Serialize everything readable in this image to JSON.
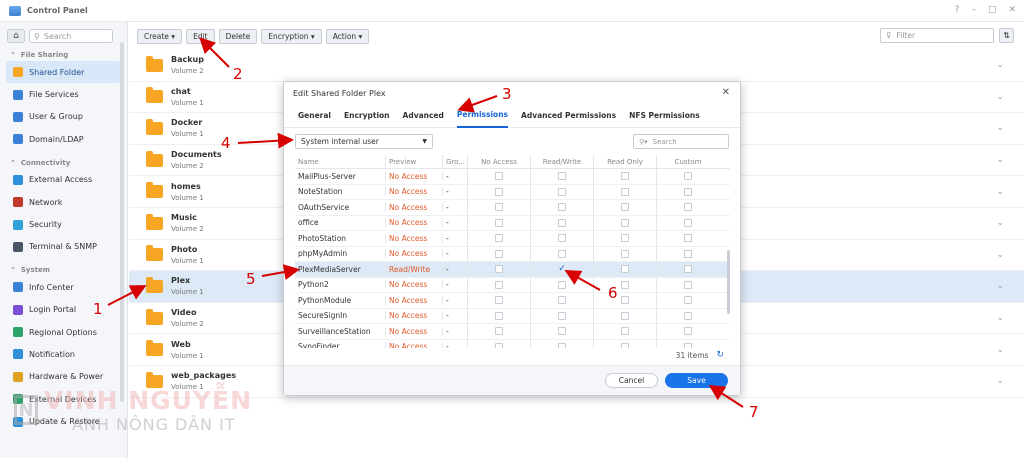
{
  "window": {
    "title": "Control Panel",
    "controls": [
      "?",
      "–",
      "□",
      "✕"
    ]
  },
  "sidebar": {
    "search_placeholder": "Search",
    "sections": [
      {
        "label": "File Sharing",
        "items": [
          {
            "label": "Shared Folder",
            "icon": "shared-folder-icon",
            "color": "#f6a623",
            "active": true
          },
          {
            "label": "File Services",
            "icon": "file-services-icon",
            "color": "#3b82d6"
          },
          {
            "label": "User & Group",
            "icon": "user-group-icon",
            "color": "#3b82d6"
          },
          {
            "label": "Domain/LDAP",
            "icon": "domain-ldap-icon",
            "color": "#3b82d6"
          }
        ]
      },
      {
        "label": "Connectivity",
        "items": [
          {
            "label": "External Access",
            "icon": "globe-icon",
            "color": "#2f8fd8"
          },
          {
            "label": "Network",
            "icon": "network-icon",
            "color": "#c0392b"
          },
          {
            "label": "Security",
            "icon": "shield-icon",
            "color": "#2fa3d8"
          },
          {
            "label": "Terminal & SNMP",
            "icon": "terminal-icon",
            "color": "#4a5568"
          }
        ]
      },
      {
        "label": "System",
        "items": [
          {
            "label": "Info Center",
            "icon": "info-icon",
            "color": "#3b82d6"
          },
          {
            "label": "Login Portal",
            "icon": "login-portal-icon",
            "color": "#7b4fd6"
          },
          {
            "label": "Regional Options",
            "icon": "regional-icon",
            "color": "#2fa36b"
          },
          {
            "label": "Notification",
            "icon": "notification-icon",
            "color": "#2f8fd8"
          },
          {
            "label": "Hardware & Power",
            "icon": "hardware-icon",
            "color": "#e0a020"
          },
          {
            "label": "External Devices",
            "icon": "external-devices-icon",
            "color": "#2fa36b"
          },
          {
            "label": "Update & Restore",
            "icon": "update-icon",
            "color": "#2f8fd8"
          }
        ]
      }
    ]
  },
  "toolbar": {
    "buttons": [
      "Create ▾",
      "Edit",
      "Delete",
      "Encryption ▾",
      "Action ▾"
    ],
    "filter_placeholder": "Filter"
  },
  "folders": [
    {
      "name": "Backup",
      "volume": "Volume 2"
    },
    {
      "name": "chat",
      "volume": "Volume 1"
    },
    {
      "name": "Docker",
      "volume": "Volume 1"
    },
    {
      "name": "Documents",
      "volume": "Volume 2"
    },
    {
      "name": "homes",
      "volume": "Volume 1"
    },
    {
      "name": "Music",
      "volume": "Volume 2"
    },
    {
      "name": "Photo",
      "volume": "Volume 1"
    },
    {
      "name": "Plex",
      "volume": "Volume 1",
      "selected": true
    },
    {
      "name": "Video",
      "volume": "Volume 2"
    },
    {
      "name": "Web",
      "volume": "Volume 1"
    },
    {
      "name": "web_packages",
      "volume": "Volume 1"
    }
  ],
  "dialog": {
    "title": "Edit Shared Folder Plex",
    "tabs": [
      "General",
      "Encryption",
      "Advanced",
      "Permissions",
      "Advanced Permissions",
      "NFS Permissions"
    ],
    "active_tab": "Permissions",
    "user_type": "System internal user",
    "search_placeholder": "Search",
    "columns": [
      "Name",
      "Preview",
      "Gro...",
      "No Access",
      "Read/Write",
      "Read Only",
      "Custom"
    ],
    "rows": [
      {
        "name": "MailPlus-Server",
        "preview": "No Access",
        "group": "-"
      },
      {
        "name": "NoteStation",
        "preview": "No Access",
        "group": "-"
      },
      {
        "name": "OAuthService",
        "preview": "No Access",
        "group": "-"
      },
      {
        "name": "office",
        "preview": "No Access",
        "group": "-"
      },
      {
        "name": "PhotoStation",
        "preview": "No Access",
        "group": "-"
      },
      {
        "name": "phpMyAdmin",
        "preview": "No Access",
        "group": "-"
      },
      {
        "name": "PlexMediaServer",
        "preview": "Read/Write",
        "group": "-",
        "selected": true,
        "checked": "rw"
      },
      {
        "name": "Python2",
        "preview": "No Access",
        "group": "-"
      },
      {
        "name": "PythonModule",
        "preview": "No Access",
        "group": "-"
      },
      {
        "name": "SecureSignIn",
        "preview": "No Access",
        "group": "-"
      },
      {
        "name": "SurveillanceStation",
        "preview": "No Access",
        "group": "-"
      },
      {
        "name": "SynoFinder",
        "preview": "No Access",
        "group": "-"
      }
    ],
    "items_count": "31 items",
    "cancel_label": "Cancel",
    "save_label": "Save"
  },
  "annotations": [
    "1",
    "2",
    "3",
    "4",
    "5",
    "6",
    "7"
  ],
  "watermark": {
    "line1": "VINH NGUYỄN",
    "line2": "ANH NÔNG DÂN IT"
  }
}
